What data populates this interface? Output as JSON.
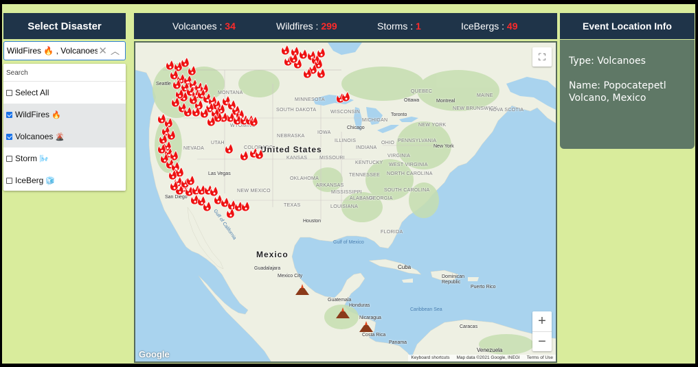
{
  "left_panel": {
    "title": "Select Disaster",
    "selected_value": "WildFires 🔥 , Volcanoes 🌋",
    "search_placeholder": "Search",
    "options": [
      {
        "label": "Select All",
        "emoji": "",
        "checked": false
      },
      {
        "label": "WildFires",
        "emoji": "🔥",
        "checked": true
      },
      {
        "label": "Volcanoes",
        "emoji": "🌋",
        "checked": true
      },
      {
        "label": "Storm",
        "emoji": "🌬️",
        "checked": false
      },
      {
        "label": "IceBerg",
        "emoji": "🧊",
        "checked": false
      }
    ]
  },
  "stats": {
    "volcanoes_label": "Volcanoes : ",
    "volcanoes_count": "34",
    "wildfires_label": "Wildfires : ",
    "wildfires_count": "299",
    "storms_label": "Storms : ",
    "storms_count": "1",
    "icebergs_label": "IceBergs : ",
    "icebergs_count": "49",
    "count_color": "#ff2a2a"
  },
  "info_panel": {
    "title": "Event Location Info",
    "type_text": "Type: Volcanoes",
    "name_text": "Name: Popocatepetl Volcano, Mexico"
  },
  "map": {
    "google_logo": "Google",
    "attribution": [
      "Keyboard shortcuts",
      "Map data ©2021 Google, INEGI",
      "Terms of Use"
    ],
    "zoom_in": "+",
    "zoom_out": "−",
    "fullscreen": "⛶",
    "countries": {
      "us": "United States",
      "mexico": "Mexico"
    },
    "states": {
      "montana": "MONTANA",
      "minnesota": "MINNESOTA",
      "south_dakota": "SOUTH DAKOTA",
      "wisconsin": "WISCONSIN",
      "wyoming": "WYOMING",
      "michigan": "MICHIGAN",
      "nebraska": "NEBRASKA",
      "iowa": "IOWA",
      "illinois": "ILLINOIS",
      "nevada": "NEVADA",
      "utah": "UTAH",
      "colorado": "COLORADO",
      "kansas": "KANSAS",
      "missouri": "MISSOURI",
      "kentucky": "KENTUCKY",
      "virginia": "VIRGINIA",
      "oklahoma": "OKLAHOMA",
      "arkansas": "ARKANSAS",
      "tennessee": "TENNESSEE",
      "north_carolina": "NORTH CAROLINA",
      "new_mexico": "NEW MEXICO",
      "mississippi": "MISSISSIPPI",
      "alabama": "ALABAMA",
      "georgia": "GEORGIA",
      "texas": "TEXAS",
      "maine": "MAINE",
      "new_york": "NEW YORK",
      "pennsylvania": "PENNSYLVANIA",
      "ohio": "OHIO",
      "indiana": "INDIANA",
      "west_virginia": "WEST VIRGINIA",
      "south_carolina": "SOUTH CAROLINA",
      "louisiana": "LOUISIANA",
      "florida": "FLORIDA",
      "quebec": "QUEBEC",
      "new_brunswick": "NEW BRUNSWICK",
      "nova_scotia": "NOVA SCOTIA"
    },
    "cities": {
      "seattle": "Seattle",
      "ottawa": "Ottawa",
      "montreal": "Montreal",
      "toronto": "Toronto",
      "chicago": "Chicago",
      "new_york": "New York",
      "las_vegas": "Las Vegas",
      "san_diego": "San Diego",
      "houston": "Houston",
      "guadalajara": "Guadalajara",
      "mexico_city": "Mexico City",
      "cuba": "Cuba",
      "dominican_republic": "Dominican Republic",
      "puerto_rico": "Puerto Rico",
      "guatemala": "Guatemala",
      "honduras": "Honduras",
      "nicaragua": "Nicaragua",
      "costa_rica": "Costa Rica",
      "panama": "Panama",
      "caracas": "Caracas",
      "venezuela": "Venezuela"
    },
    "waters": {
      "gulf_of_mexico": "Gulf of Mexico",
      "caribbean_sea": "Caribbean Sea",
      "gulf_of_california": "Gulf of California"
    },
    "colors": {
      "water": "#a9d3ee",
      "land": "#eef0e3",
      "forest": "#c6deb0",
      "fire": "#ee1111",
      "volcano": "#8b3a1a"
    }
  }
}
